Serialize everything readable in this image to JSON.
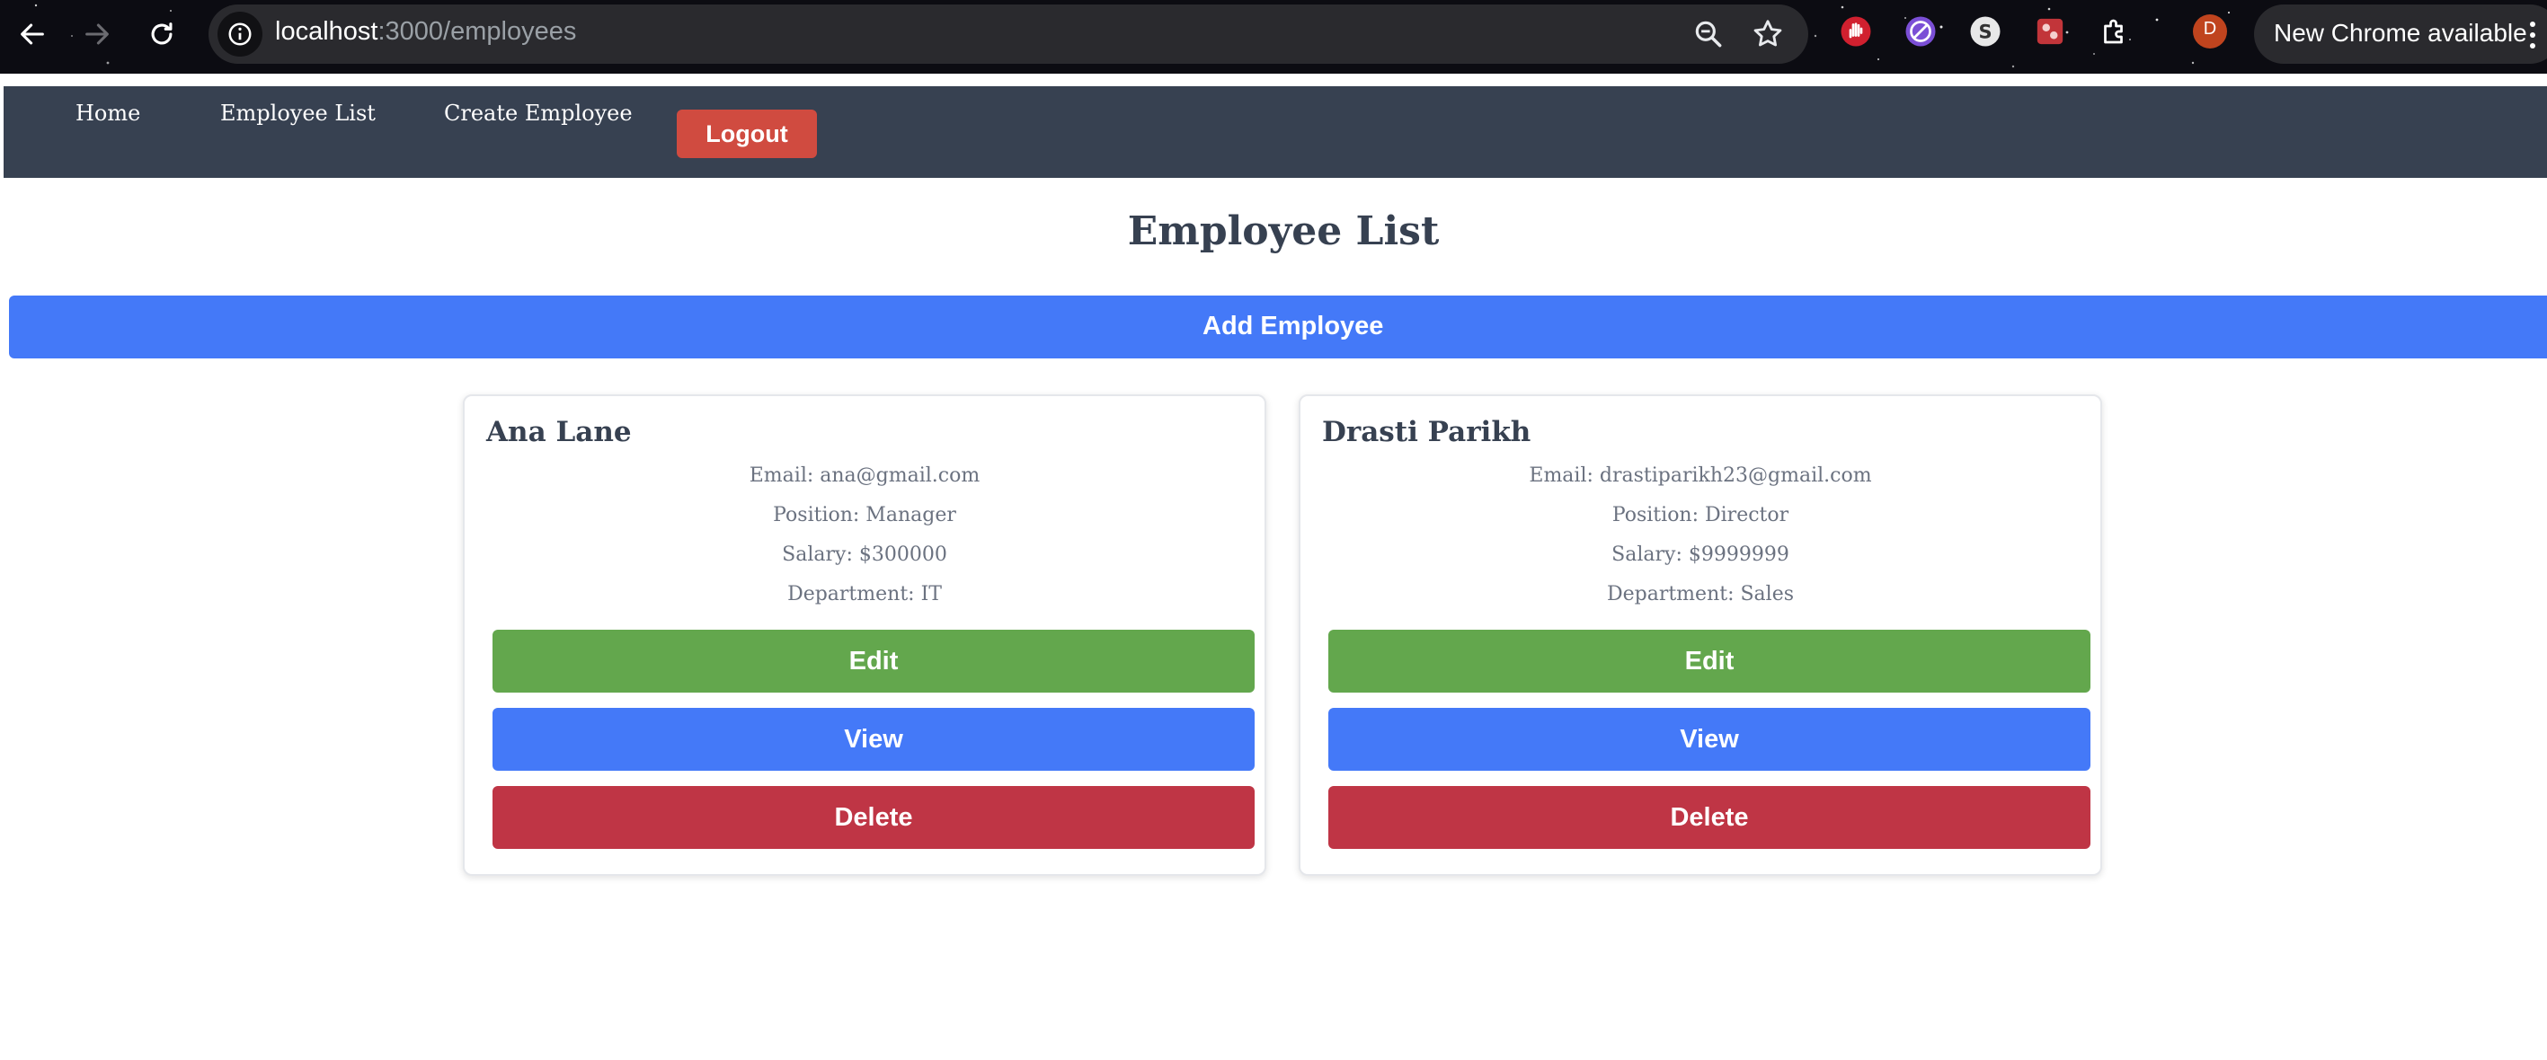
{
  "browser": {
    "url_host": "localhost",
    "url_path": ":3000/employees",
    "profile_initial": "D",
    "update_label": "New Chrome available",
    "icons": [
      "back-arrow-icon",
      "forward-arrow-icon",
      "reload-icon",
      "site-info-icon",
      "zoom-icon",
      "bookmark-star-icon",
      "hand-extension-icon",
      "compass-extension-icon",
      "s-extension-icon",
      "puzzle-extensions-icon",
      "kebab-menu-icon"
    ]
  },
  "nav": {
    "home": "Home",
    "employee_list": "Employee List",
    "create_employee": "Create Employee",
    "logout": "Logout"
  },
  "main": {
    "title": "Employee List",
    "add_button": "Add Employee"
  },
  "employees": [
    {
      "name": "Ana Lane",
      "email": "Email: ana@gmail.com",
      "position": "Position: Manager",
      "salary": "Salary: $300000",
      "department": "Department: IT",
      "edit": "Edit",
      "view": "View",
      "delete": "Delete"
    },
    {
      "name": "Drasti Parikh",
      "email": "Email: drastiparikh23@gmail.com",
      "position": "Position: Director",
      "salary": "Salary: $9999999",
      "department": "Department: Sales",
      "edit": "Edit",
      "view": "View",
      "delete": "Delete"
    }
  ],
  "colors": {
    "nav_bg": "#374151",
    "logout": "#d04b40",
    "primary_blue": "#4479f8",
    "edit_green": "#63a74d",
    "delete_red": "#bf3545"
  }
}
